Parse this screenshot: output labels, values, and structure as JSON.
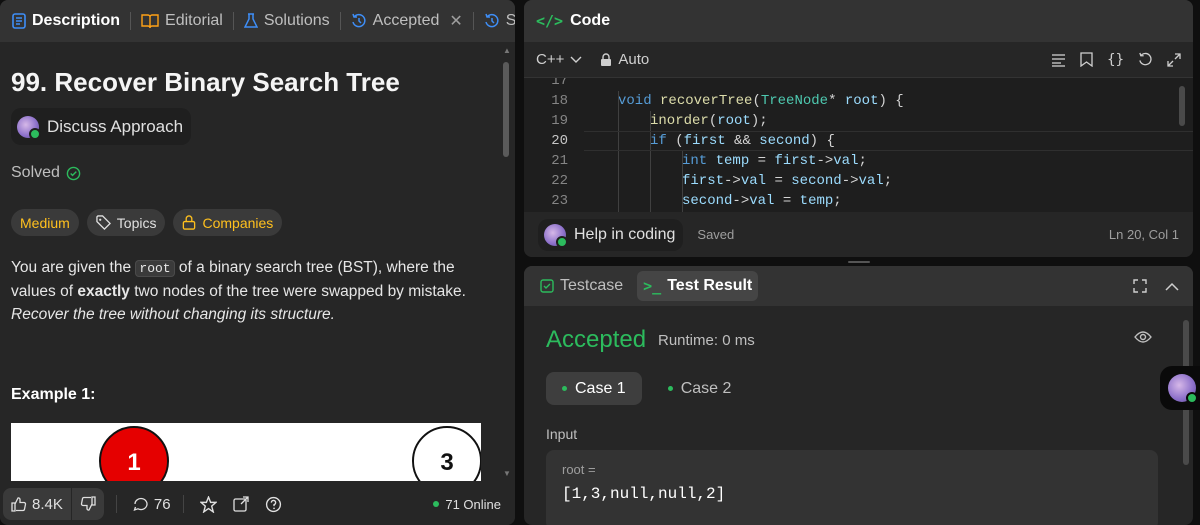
{
  "left_tabs": [
    {
      "label": "Description",
      "icon": "document-icon"
    },
    {
      "label": "Editorial",
      "icon": "book-icon"
    },
    {
      "label": "Solutions",
      "icon": "flask-icon"
    },
    {
      "label": "Accepted",
      "icon": "history-icon"
    },
    {
      "label": "Su",
      "icon": "history-icon"
    }
  ],
  "problem": {
    "title": "99. Recover Binary Search Tree",
    "discuss_label": "Discuss Approach",
    "solved_label": "Solved",
    "difficulty": "Medium",
    "topics_label": "Topics",
    "companies_label": "Companies",
    "desc_part1": "You are given the ",
    "desc_code": "root",
    "desc_part2": " of a binary search tree (BST), where the values of ",
    "desc_bold": "exactly",
    "desc_part3": " two nodes of the tree were swapped by mistake.",
    "desc_italic": "Recover the tree without changing its structure.",
    "example_title": "Example 1:",
    "node_a": "1",
    "node_b": "3"
  },
  "footer": {
    "likes": "8.4K",
    "comments": "76",
    "online": "71 Online"
  },
  "code_panel": {
    "title": "Code",
    "language": "C++",
    "mode": "Auto",
    "lines": [
      {
        "n": "17",
        "indent": 0,
        "html": ""
      },
      {
        "n": "18",
        "indent": 1,
        "html": "<span class=\"kw\">void</span> <span class=\"fn\">recoverTree</span>(<span class=\"ty\">TreeNode</span>* <span class=\"id\">root</span>) {"
      },
      {
        "n": "19",
        "indent": 2,
        "html": "<span class=\"fn\">inorder</span>(<span class=\"id\">root</span>);"
      },
      {
        "n": "20",
        "indent": 2,
        "html": "<span class=\"kw\">if</span> (<span class=\"id\">first</span> && <span class=\"id\">second</span>) {"
      },
      {
        "n": "21",
        "indent": 3,
        "html": "<span class=\"kw\">int</span> <span class=\"id\">temp</span> = <span class=\"id\">first</span>-><span class=\"id\">val</span>;"
      },
      {
        "n": "22",
        "indent": 3,
        "html": "<span class=\"id\">first</span>-><span class=\"id\">val</span> = <span class=\"id\">second</span>-><span class=\"id\">val</span>;"
      },
      {
        "n": "23",
        "indent": 3,
        "html": "<span class=\"id\">second</span>-><span class=\"id\">val</span> = <span class=\"id\">temp</span>;"
      }
    ],
    "current_line": "20",
    "help_label": "Help in coding",
    "saved_label": "Saved",
    "cursor_pos": "Ln 20, Col 1"
  },
  "test_panel": {
    "tab_testcase": "Testcase",
    "tab_result": "Test Result",
    "status": "Accepted",
    "runtime": "Runtime: 0 ms",
    "cases": [
      "Case 1",
      "Case 2"
    ],
    "input_label": "Input",
    "input_name": "root =",
    "input_value": "[1,3,null,null,2]"
  },
  "colors": {
    "accent_green": "#2cbb5d",
    "medium_yellow": "#ffc01e",
    "panel_bg": "#262626"
  }
}
